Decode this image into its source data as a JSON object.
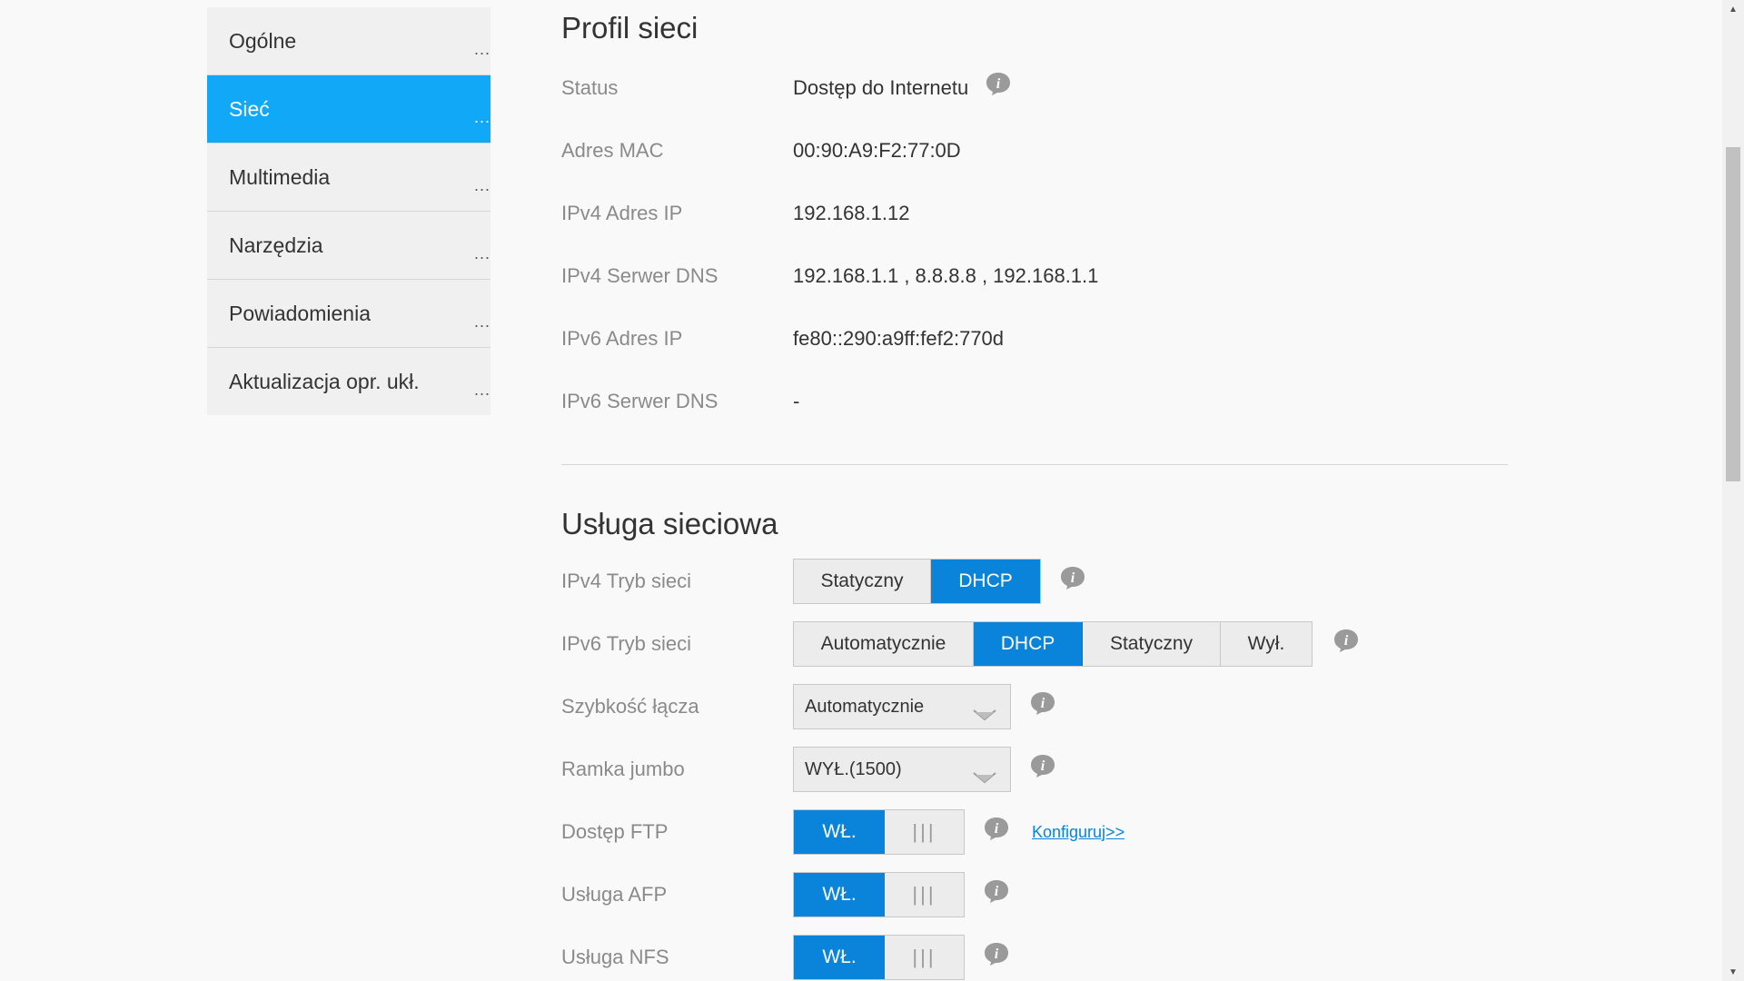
{
  "sidebar": {
    "items": [
      {
        "label": "Ogólne",
        "dots": "..."
      },
      {
        "label": "Sieć",
        "dots": "...",
        "active": true
      },
      {
        "label": "Multimedia",
        "dots": "..."
      },
      {
        "label": "Narzędzia",
        "dots": "..."
      },
      {
        "label": "Powiadomienia",
        "dots": "..."
      },
      {
        "label": "Aktualizacja opr. ukł.",
        "dots": "..."
      }
    ]
  },
  "profile": {
    "title": "Profil sieci",
    "status_label": "Status",
    "status_value": "Dostęp do Internetu",
    "mac_label": "Adres MAC",
    "mac_value": "00:90:A9:F2:77:0D",
    "ipv4_ip_label": "IPv4 Adres IP",
    "ipv4_ip_value": "192.168.1.12",
    "ipv4_dns_label": "IPv4 Serwer DNS",
    "ipv4_dns_value": "192.168.1.1 , 8.8.8.8 , 192.168.1.1",
    "ipv6_ip_label": "IPv6 Adres IP",
    "ipv6_ip_value": "fe80::290:a9ff:fef2:770d",
    "ipv6_dns_label": "IPv6 Serwer DNS",
    "ipv6_dns_value": "-"
  },
  "service": {
    "title": "Usługa sieciowa",
    "ipv4_mode_label": "IPv4 Tryb sieci",
    "ipv4_mode_options": [
      "Statyczny",
      "DHCP"
    ],
    "ipv4_mode_selected": "DHCP",
    "ipv6_mode_label": "IPv6 Tryb sieci",
    "ipv6_mode_options": [
      "Automatycznie",
      "DHCP",
      "Statyczny",
      "Wył."
    ],
    "ipv6_mode_selected": "DHCP",
    "link_speed_label": "Szybkość łącza",
    "link_speed_value": "Automatycznie",
    "jumbo_label": "Ramka jumbo",
    "jumbo_value": "WYŁ.(1500)",
    "ftp_label": "Dostęp FTP",
    "ftp_state": "WŁ.",
    "ftp_link": "Konfiguruj>>",
    "afp_label": "Usługa AFP",
    "afp_state": "WŁ.",
    "nfs_label": "Usługa NFS",
    "nfs_state": "WŁ.",
    "toggle_handle": "|||"
  },
  "colors": {
    "accent": "#0a84db",
    "sidebar_active": "#11a8f7",
    "background": "#f9f9f9"
  },
  "icons": {
    "info": "info-icon",
    "dropdown": "chevron-down-icon"
  }
}
